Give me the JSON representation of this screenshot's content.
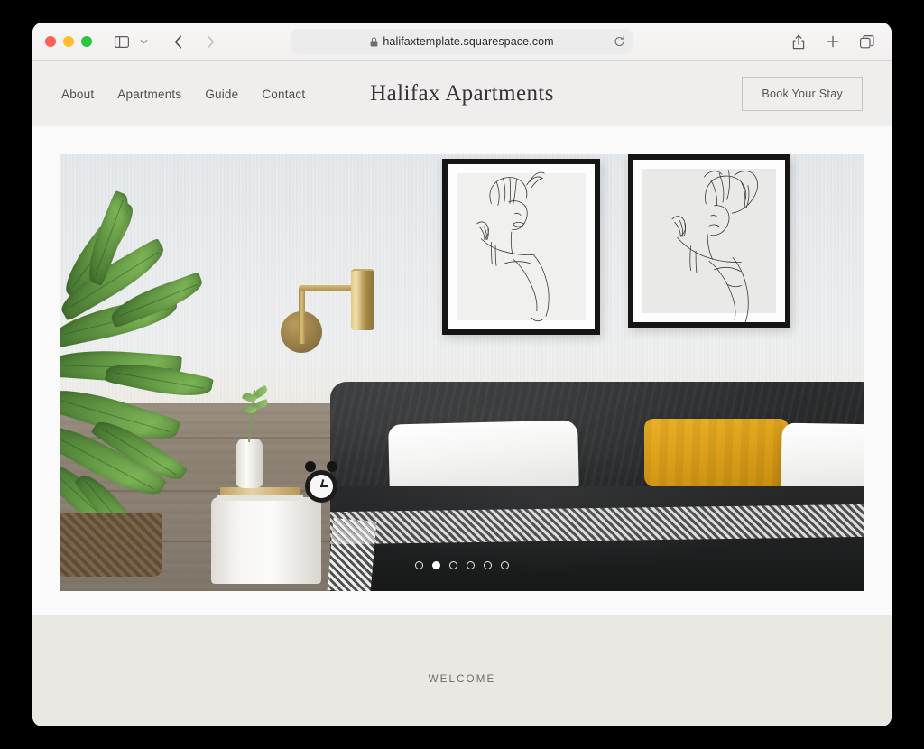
{
  "browser": {
    "traffic_lights": [
      "close",
      "minimize",
      "maximize"
    ],
    "sidebar_toggle": "sidebar-toggle-icon",
    "tab_overview_chevron": "chevron-down-icon",
    "back_label": "‹",
    "forward_label": "›",
    "url": "halifaxtemplate.squarespace.com",
    "lock": "lock-icon",
    "reload": "reload-icon",
    "share": "share-icon",
    "new_tab": "plus-icon",
    "tabs": "tab-overview-icon"
  },
  "site": {
    "title": "Halifax Apartments",
    "nav": [
      {
        "label": "About"
      },
      {
        "label": "Apartments"
      },
      {
        "label": "Guide"
      },
      {
        "label": "Contact"
      }
    ],
    "cta": {
      "label": "Book Your Stay"
    },
    "header_bg": "#efeeec"
  },
  "hero": {
    "alt": "Modern bedroom with dark upholstered bed, white pillows, mustard accent cushion, brass wall sconce, two framed line-art prints, white round nightstand and large green plant",
    "carousel": {
      "total": 6,
      "active_index": 1,
      "dots": [
        1,
        2,
        3,
        4,
        5,
        6
      ]
    },
    "colors": {
      "wall": "#e7eaec",
      "wood_panel": "#8a8073",
      "bed": "#242526",
      "accent_cushion": "#dda01a",
      "brass": "#c2a862",
      "plant_green": "#5f9442"
    }
  },
  "welcome": {
    "text": "WELCOME",
    "background": "#eae8e3"
  }
}
